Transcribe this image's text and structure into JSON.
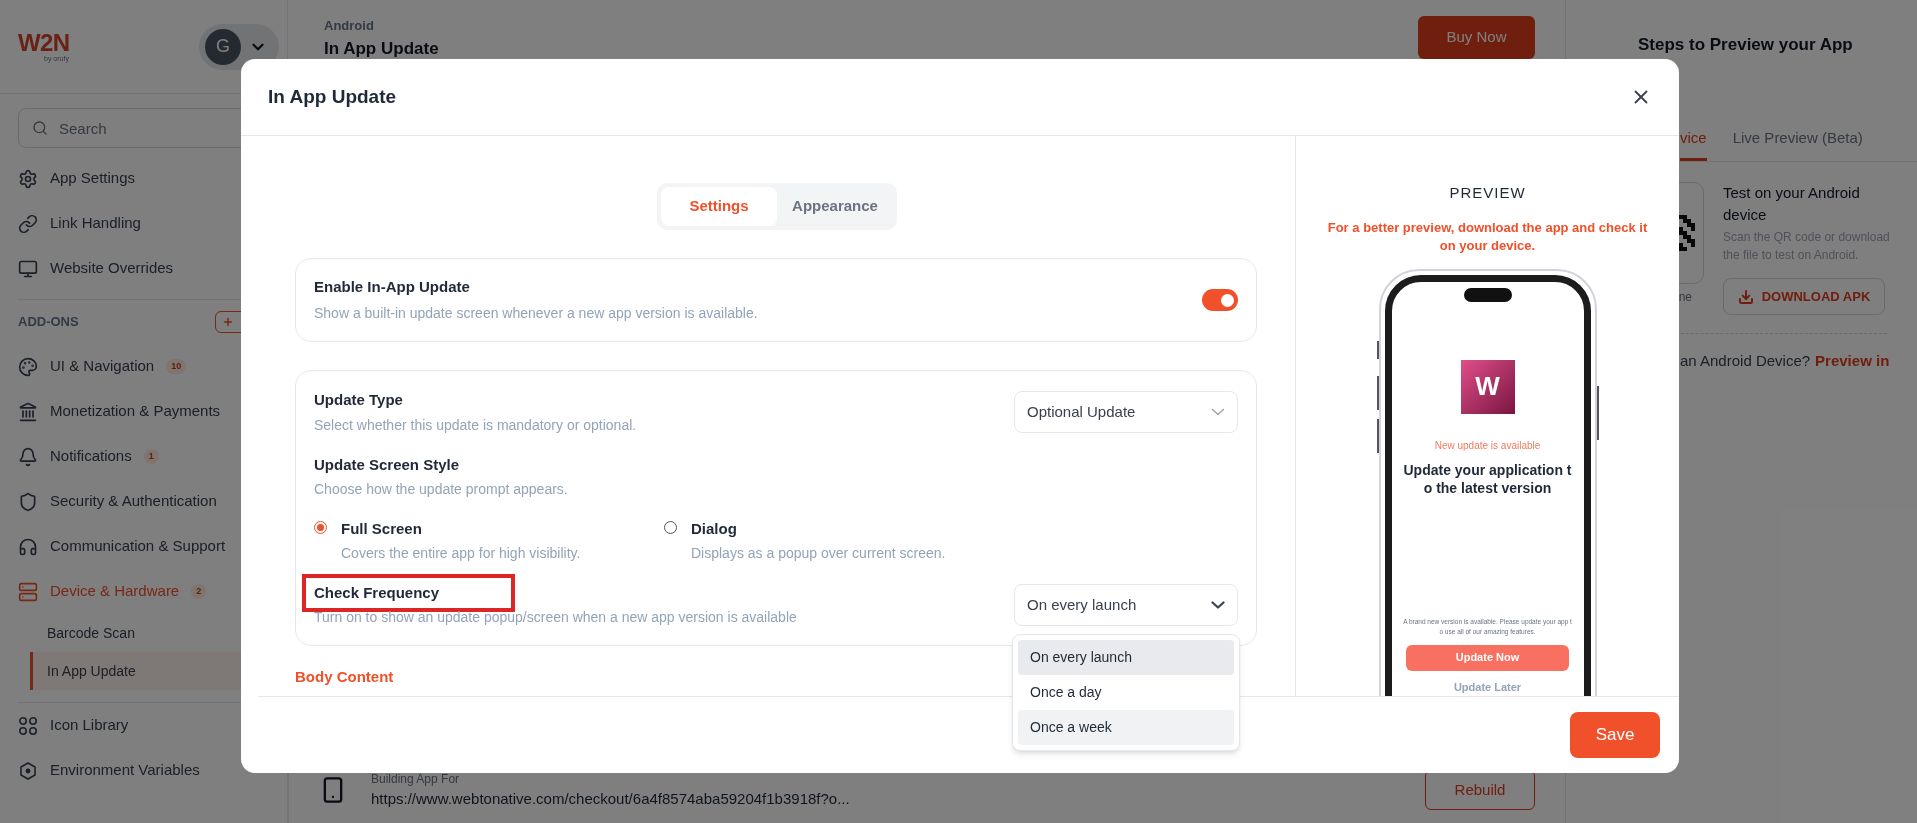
{
  "sidebar": {
    "logo_text": "W2N",
    "logo_tagline": "by orufy",
    "avatar_initial": "G",
    "search_placeholder": "Search",
    "top_items": [
      {
        "label": "App Settings",
        "selected": false
      },
      {
        "label": "Link Handling",
        "selected": false
      },
      {
        "label": "Website Overrides",
        "selected": false
      }
    ],
    "addons_heading": "ADD-ONS",
    "addon_items": [
      {
        "label": "UI & Navigation",
        "badge": "10",
        "selected": false
      },
      {
        "label": "Monetization & Payments",
        "selected": false
      },
      {
        "label": "Notifications",
        "badge": "1",
        "selected": false
      },
      {
        "label": "Security & Authentication",
        "selected": false
      },
      {
        "label": "Communication & Support",
        "selected": false
      },
      {
        "label": "Device & Hardware",
        "badge": "2",
        "selected": true,
        "children": [
          {
            "label": "Barcode Scan",
            "selected": false
          },
          {
            "label": "In App Update",
            "selected": true
          }
        ]
      }
    ],
    "bottom_items": [
      {
        "label": "Icon Library",
        "selected": false
      },
      {
        "label": "Environment Variables",
        "selected": false
      }
    ]
  },
  "main": {
    "platform": "Android",
    "title": "In App Update",
    "buy_button": "Buy Now",
    "build_label": "Building App For",
    "build_url": "https://www.webtonative.com/checkout/6a4f8574aba59204f1b3918f?o...",
    "rebuild_button": "Rebuild"
  },
  "preview_panel": {
    "title": "Steps to Preview your App",
    "tabs": [
      {
        "label": "vice",
        "selected": true
      },
      {
        "label": "Live Preview (Beta)",
        "selected": false
      }
    ],
    "qr_caption": "ne",
    "test_title": "Test on your Android device",
    "test_description": "Scan the QR code or download the file to test on Android.",
    "download_button": "DOWNLOAD APK",
    "question": "an Android Device?",
    "question_link": "Preview in"
  },
  "modal": {
    "title": "In App Update",
    "tabs": [
      {
        "label": "Settings",
        "selected": true
      },
      {
        "label": "Appearance",
        "selected": false
      }
    ],
    "enable": {
      "title": "Enable In-App Update",
      "description": "Show a built-in update screen whenever a new app version is available.",
      "on": true
    },
    "fields": [
      {
        "kind": "select",
        "title": "Update Type",
        "description": "Select whether this update is mandatory or optional.",
        "value": "Optional Update",
        "expanded": false,
        "highlighted": false
      },
      {
        "kind": "radio",
        "title": "Update Screen Style",
        "description": "Choose how the update prompt appears.",
        "options": [
          {
            "label": "Full Screen",
            "description": "Covers the entire app for high visibility.",
            "selected": true
          },
          {
            "label": "Dialog",
            "description": "Displays as a popup over current screen.",
            "selected": false
          }
        ]
      },
      {
        "kind": "select",
        "title": "Check Frequency",
        "description": "Turn on to show an update popup/screen when a new app version is available",
        "value": "On every launch",
        "expanded": true,
        "highlighted": true,
        "options": [
          {
            "label": "On every launch",
            "selected": true,
            "hovered": false
          },
          {
            "label": "Once a day",
            "selected": false,
            "hovered": false
          },
          {
            "label": "Once a week",
            "selected": false,
            "hovered": true
          }
        ]
      }
    ],
    "section_heading": "Body Content",
    "save_button": "Save",
    "preview": {
      "heading": "PREVIEW",
      "note": "For a better preview, download the app and check it on your device.",
      "app_initial": "W",
      "update_label": "New update is available",
      "update_title": "Update your application to the latest version",
      "update_body": "A brand new version is available. Please update your app to use all of our amazing features.",
      "primary_button": "Update Now",
      "secondary_button": "Update Later"
    }
  }
}
